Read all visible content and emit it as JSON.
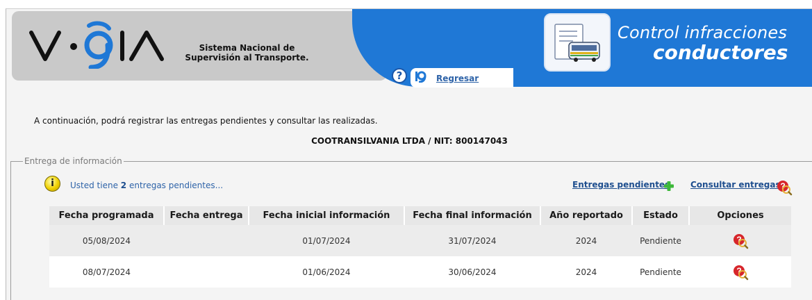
{
  "header": {
    "logo_text": "VIGIA",
    "tagline": "Sistema Nacional de Supervisión al Transporte.",
    "help_label": "?",
    "back_label": "Regresar",
    "module_title_line1": "Control infracciones",
    "module_title_line2": "conductores"
  },
  "intro_text": "A continuación, podrá registrar las entregas pendientes y consultar las realizadas.",
  "company_line": "COOTRANSILVANIA LTDA / NIT: 800147043",
  "section": {
    "legend": "Entrega de información",
    "pending_prefix": "Usted tiene ",
    "pending_count": "2",
    "pending_suffix": " entregas pendientes...",
    "link_pending": "Entregas pendientes",
    "link_consult": "Consultar entregas"
  },
  "table": {
    "headers": [
      "Fecha programada",
      "Fecha entrega",
      "Fecha inicial información",
      "Fecha final información",
      "Año reportado",
      "Estado",
      "Opciones"
    ],
    "rows": [
      {
        "fecha_programada": "05/08/2024",
        "fecha_entrega": "",
        "fecha_inicial": "01/07/2024",
        "fecha_final": "31/07/2024",
        "anio": "2024",
        "estado": "Pendiente",
        "opcion_icon": "consult-icon"
      },
      {
        "fecha_programada": "08/07/2024",
        "fecha_entrega": "",
        "fecha_inicial": "01/06/2024",
        "fecha_final": "30/06/2024",
        "anio": "2024",
        "estado": "Pendiente",
        "opcion_icon": "consult-icon"
      }
    ]
  },
  "colors": {
    "header_blue": "#1f78d6",
    "header_grey": "#c9c9c9",
    "link_blue": "#1f4f8f",
    "icon_red": "#d7262b",
    "plus_green": "#3db83a"
  }
}
